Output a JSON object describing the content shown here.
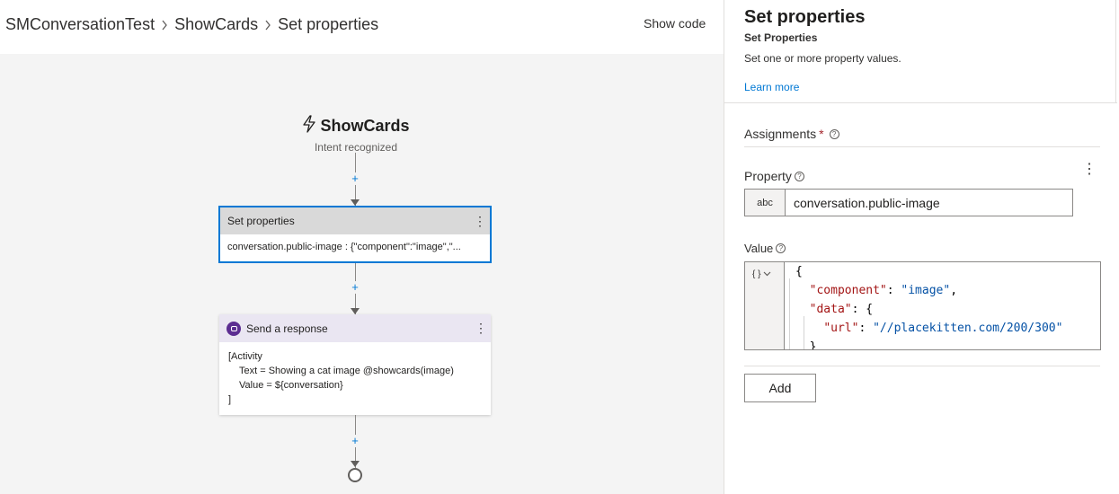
{
  "breadcrumb": {
    "items": [
      "SMConversationTest",
      "ShowCards",
      "Set properties"
    ]
  },
  "header": {
    "show_code_label": "Show code"
  },
  "canvas": {
    "trigger": {
      "title": "ShowCards",
      "subtitle": "Intent recognized"
    },
    "set_properties_card": {
      "title": "Set properties",
      "body": "conversation.public-image : {\"component\":\"image\",\"..."
    },
    "send_response_card": {
      "title": "Send a response",
      "lines": [
        "[Activity",
        "Text = Showing a cat image @showcards(image)",
        "Value = ${conversation}",
        "]"
      ]
    },
    "add_node_label": "+"
  },
  "panel": {
    "title": "Set properties",
    "subtitle": "Set Properties",
    "description": "Set one or more property values.",
    "learn_more": "Learn more",
    "assignments_label": "Assignments",
    "required_mark": "*",
    "property_label": "Property",
    "property_type": "abc",
    "property_value": "conversation.public-image",
    "value_label": "Value",
    "value_type": "{ }",
    "code": {
      "open_brace": "{",
      "key_component": "\"component\"",
      "val_component": "\"image\"",
      "key_data": "\"data\"",
      "key_url": "\"url\"",
      "val_url": "\"//placekitten.com/200/300\"",
      "close_brace": "}"
    },
    "add_button": "Add"
  },
  "colors": {
    "accent": "#0078d4",
    "bot": "#5c2d91",
    "required": "#a4262c"
  }
}
